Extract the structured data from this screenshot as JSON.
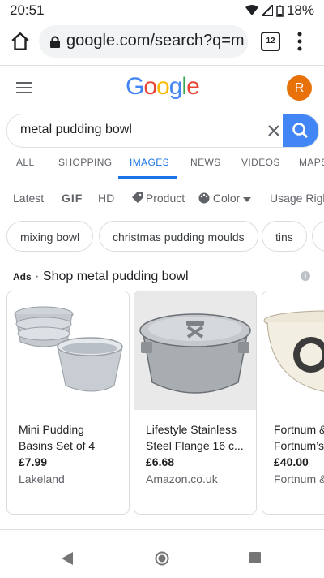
{
  "status_bar": {
    "time": "20:51",
    "battery": "18%"
  },
  "browser": {
    "url": "google.com/search?q=m",
    "tab_count": "12"
  },
  "google": {
    "logo": "Google",
    "avatar_letter": "R"
  },
  "search": {
    "query": "metal pudding bowl"
  },
  "nav_tabs": [
    "ALL",
    "SHOPPING",
    "IMAGES",
    "NEWS",
    "VIDEOS",
    "MAPS"
  ],
  "filters": {
    "latest": "Latest",
    "gif": "GIF",
    "hd": "HD",
    "product": "Product",
    "color": "Color",
    "usage": "Usage Rights"
  },
  "chips": [
    "mixing bowl",
    "christmas pudding moulds",
    "tins"
  ],
  "ads": {
    "badge": "Ads",
    "title": "Shop metal pudding bowl"
  },
  "products": [
    {
      "title": "Mini Pudding Basins Set of 4",
      "price": "£7.99",
      "store": "Lakeland"
    },
    {
      "title": "Lifestyle Stainless Steel Flange 16 c...",
      "price": "£6.68",
      "store": "Amazon.co.uk"
    },
    {
      "title": "Fortnum & Fortnum’s",
      "price": "£40.00",
      "store": "Fortnum &"
    }
  ],
  "colors": {
    "accent": "#1a73e8",
    "search_button": "#4285f4",
    "avatar": "#e8710a"
  }
}
